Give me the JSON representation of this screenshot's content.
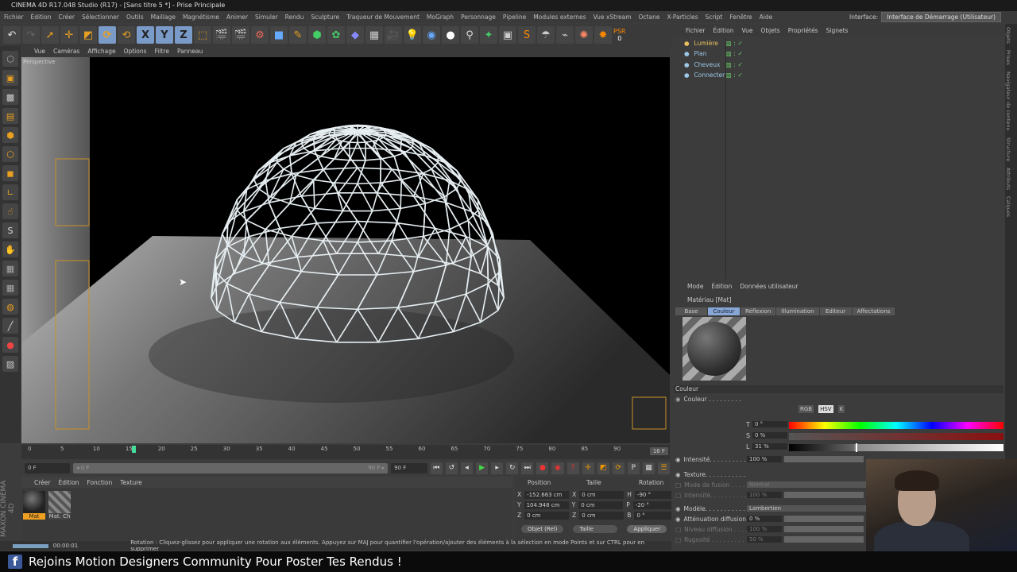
{
  "window": {
    "title": "CINEMA 4D R17.048 Studio (R17) - [Sans titre 5 *] - Prise Principale"
  },
  "menu": [
    "Fichier",
    "Édition",
    "Créer",
    "Sélectionner",
    "Outils",
    "Maillage",
    "Magnétisme",
    "Animer",
    "Simuler",
    "Rendu",
    "Sculpture",
    "Traqueur de Mouvement",
    "MoGraph",
    "Personnage",
    "Pipeline",
    "Modules externes",
    "Vue xStream",
    "Octane",
    "X-Particles",
    "Script",
    "Fenêtre",
    "Aide"
  ],
  "interface": {
    "label": "Interface:",
    "value": "Interface de Démarrage (Utilisateur)"
  },
  "toolbar": {
    "axis": [
      "X",
      "Y",
      "Z"
    ],
    "psr": "PSR",
    "psr_value": "0"
  },
  "viewport": {
    "menu": [
      "Vue",
      "Caméras",
      "Affichage",
      "Options",
      "Filtre",
      "Panneau"
    ],
    "label": "Perspective"
  },
  "timeline": {
    "ticks": [
      0,
      5,
      10,
      15,
      20,
      25,
      30,
      35,
      40,
      45,
      50,
      55,
      60,
      65,
      70,
      75,
      80,
      85,
      90
    ],
    "current": 16,
    "current_label": "16 F",
    "start": "0 F",
    "range_start": "◂ 0 F",
    "range_end": "90 F ▸",
    "end": "90 F"
  },
  "material_manager": {
    "menu": [
      "Créer",
      "Édition",
      "Fonction",
      "Texture"
    ],
    "materials": [
      "Mat",
      "Mat. Ch"
    ]
  },
  "brand": "MAXON CINEMA 4D",
  "coords": {
    "headers": [
      "Position",
      "Taille",
      "Rotation"
    ],
    "rows": [
      {
        "pl": "X",
        "p": "-152.663 cm",
        "sl": "X",
        "s": "0 cm",
        "rl": "H",
        "r": "-90 °"
      },
      {
        "pl": "Y",
        "p": "104.948 cm",
        "sl": "Y",
        "s": "0 cm",
        "rl": "P",
        "r": "-20 °"
      },
      {
        "pl": "Z",
        "p": "0 cm",
        "sl": "Z",
        "s": "0 cm",
        "rl": "B",
        "r": "0 °"
      }
    ],
    "mode": "Objet (Rel)",
    "size_mode": "Taille",
    "apply": "Appliquer"
  },
  "status": {
    "time": "00:00:01",
    "text": "Rotation : Cliquez-glissez pour appliquer une rotation aux éléments. Appuyez sur MAJ pour quantifier l'opération/ajouter des éléments à la sélection en mode Points et sur CTRL pour en supprimer"
  },
  "objects": {
    "menu": [
      "Fichier",
      "Édition",
      "Vue",
      "Objets",
      "Propriétés",
      "Signets"
    ],
    "items": [
      {
        "name": "Lumière",
        "color": "#e8c060"
      },
      {
        "name": "Plan",
        "color": "#9cc8e8"
      },
      {
        "name": "Cheveux",
        "color": "#9cc8e8"
      },
      {
        "name": "Connecter",
        "color": "#9cc8e8"
      }
    ]
  },
  "side_tabs": [
    "Objets",
    "Prises",
    "Navigateur de contenu",
    "Structure",
    "Attributs",
    "Calques"
  ],
  "attributes": {
    "menu": [
      "Mode",
      "Édition",
      "Données utilisateur"
    ],
    "title": "Matériau [Mat]",
    "tabs": [
      "Base",
      "Couleur",
      "Réflexion",
      "Illumination",
      "Editeur",
      "Affectations"
    ],
    "active_tab": "Couleur",
    "section": "Couleur",
    "color_label": "Couleur . . . . . . . . .",
    "modes": [
      "RGB",
      "HSV",
      "K"
    ],
    "hsl": [
      {
        "l": "T",
        "v": "0 °"
      },
      {
        "l": "S",
        "v": "0 %"
      },
      {
        "l": "L",
        "v": "31 %"
      }
    ],
    "lightness": 0.31,
    "props": [
      {
        "l": "Intensité. . . . . . . . . .",
        "v": "100 %",
        "dim": false
      },
      {
        "l": "Texture. . . . . . . . . . .",
        "v": "",
        "dim": false
      },
      {
        "l": "Mode de fusion . . . .",
        "v": "Normal",
        "dim": true
      },
      {
        "l": "Intensité. . . . . . . . . .",
        "v": "100 %",
        "dim": true
      },
      {
        "l": "Modèle. . . . . . . . . . . .",
        "v": "Lambertien",
        "dim": false
      },
      {
        "l": "Atténuation diffusion",
        "v": "0 %",
        "dim": false
      },
      {
        "l": "Niveau diffusion . . . .",
        "v": "100 %",
        "dim": true
      },
      {
        "l": "Rugosité . . . . . . . . .",
        "v": "50 %",
        "dim": true
      }
    ]
  },
  "banner": {
    "text": "Rejoins Motion Designers Community Pour Poster Tes Rendus !",
    "icon": "f"
  }
}
